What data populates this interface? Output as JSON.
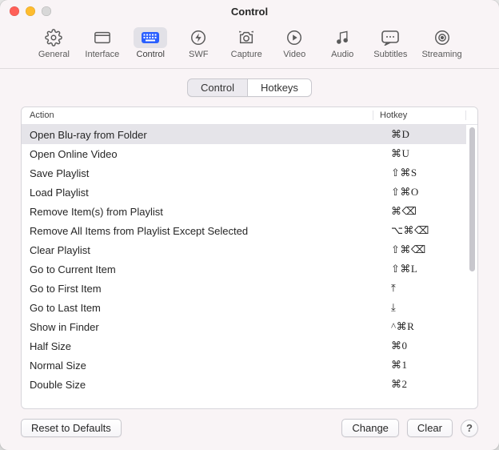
{
  "window_title": "Control",
  "toolbar": [
    {
      "id": "general",
      "label": "General",
      "icon": "gear",
      "selected": false
    },
    {
      "id": "interface",
      "label": "Interface",
      "icon": "window",
      "selected": false
    },
    {
      "id": "control",
      "label": "Control",
      "icon": "keyboard",
      "selected": true
    },
    {
      "id": "swf",
      "label": "SWF",
      "icon": "flash",
      "selected": false
    },
    {
      "id": "capture",
      "label": "Capture",
      "icon": "camera",
      "selected": false
    },
    {
      "id": "video",
      "label": "Video",
      "icon": "play",
      "selected": false
    },
    {
      "id": "audio",
      "label": "Audio",
      "icon": "note",
      "selected": false
    },
    {
      "id": "subtitles",
      "label": "Subtitles",
      "icon": "cc",
      "selected": false
    },
    {
      "id": "streaming",
      "label": "Streaming",
      "icon": "cast",
      "selected": false
    }
  ],
  "segmented": {
    "control": "Control",
    "hotkeys": "Hotkeys",
    "active": "hotkeys"
  },
  "table": {
    "headers": {
      "action": "Action",
      "hotkey": "Hotkey"
    },
    "rows": [
      {
        "action": "Open Blu-ray from Folder",
        "hotkey": "⌘D",
        "selected": true
      },
      {
        "action": "Open Online Video",
        "hotkey": "⌘U"
      },
      {
        "action": "Save Playlist",
        "hotkey": "⇧⌘S"
      },
      {
        "action": "Load Playlist",
        "hotkey": "⇧⌘O"
      },
      {
        "action": "Remove Item(s) from Playlist",
        "hotkey": "⌘⌫"
      },
      {
        "action": "Remove All Items from Playlist Except Selected",
        "hotkey": "⌥⌘⌫"
      },
      {
        "action": "Clear Playlist",
        "hotkey": "⇧⌘⌫"
      },
      {
        "action": "Go to Current Item",
        "hotkey": "⇧⌘L"
      },
      {
        "action": "Go to First Item",
        "hotkey": "⤒"
      },
      {
        "action": "Go to Last Item",
        "hotkey": "⤓"
      },
      {
        "action": "Show in Finder",
        "hotkey": "^⌘R"
      },
      {
        "action": "Half Size",
        "hotkey": "⌘0"
      },
      {
        "action": "Normal Size",
        "hotkey": "⌘1"
      },
      {
        "action": "Double Size",
        "hotkey": "⌘2"
      }
    ]
  },
  "buttons": {
    "reset": "Reset to Defaults",
    "change": "Change",
    "clear": "Clear",
    "help": "?"
  }
}
